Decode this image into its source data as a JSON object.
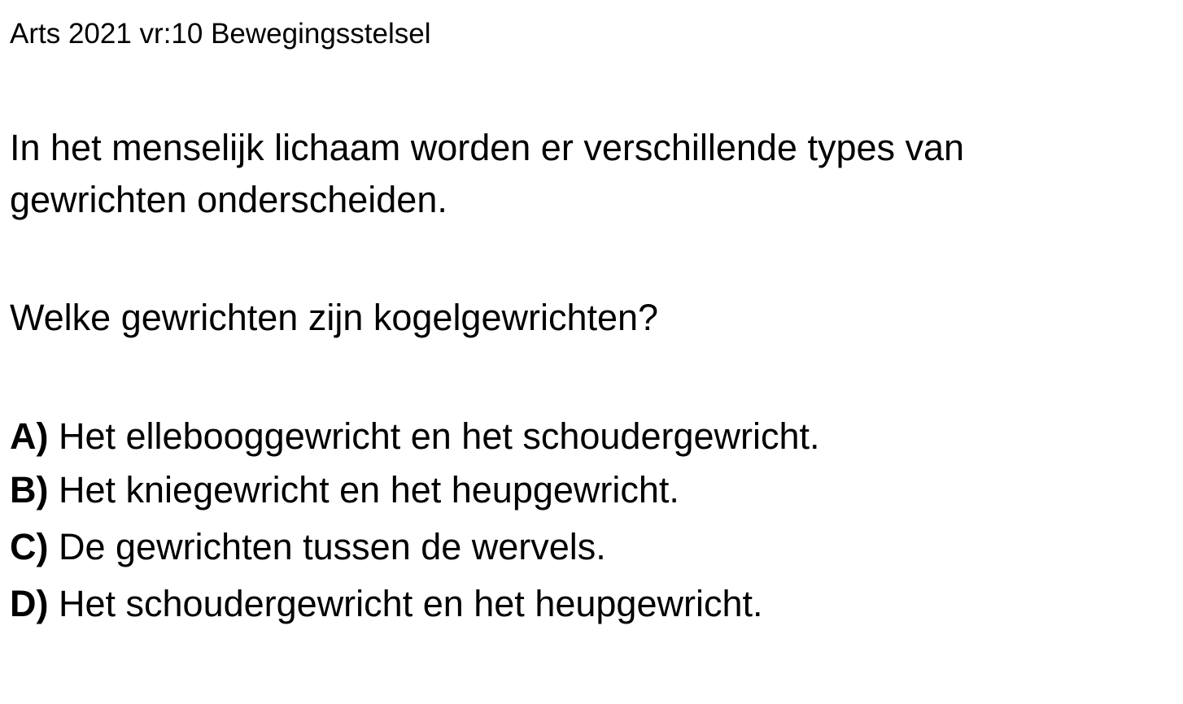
{
  "header": "Arts 2021 vr:10 Bewegingsstelsel",
  "intro_lines": [
    "In het menselijk lichaam worden er verschillende types van",
    "gewrichten onderscheiden."
  ],
  "question": "Welke gewrichten zijn kogelgewrichten?",
  "options": [
    {
      "letter": "A)",
      "text": " Het ellebooggewricht en het schoudergewricht."
    },
    {
      "letter": "B)",
      "text": " Het kniegewricht en het heupgewricht."
    },
    {
      "letter": "C)",
      "text": " De gewrichten tussen de wervels."
    },
    {
      "letter": "D)",
      "text": " Het schoudergewricht en het heupgewricht."
    }
  ]
}
